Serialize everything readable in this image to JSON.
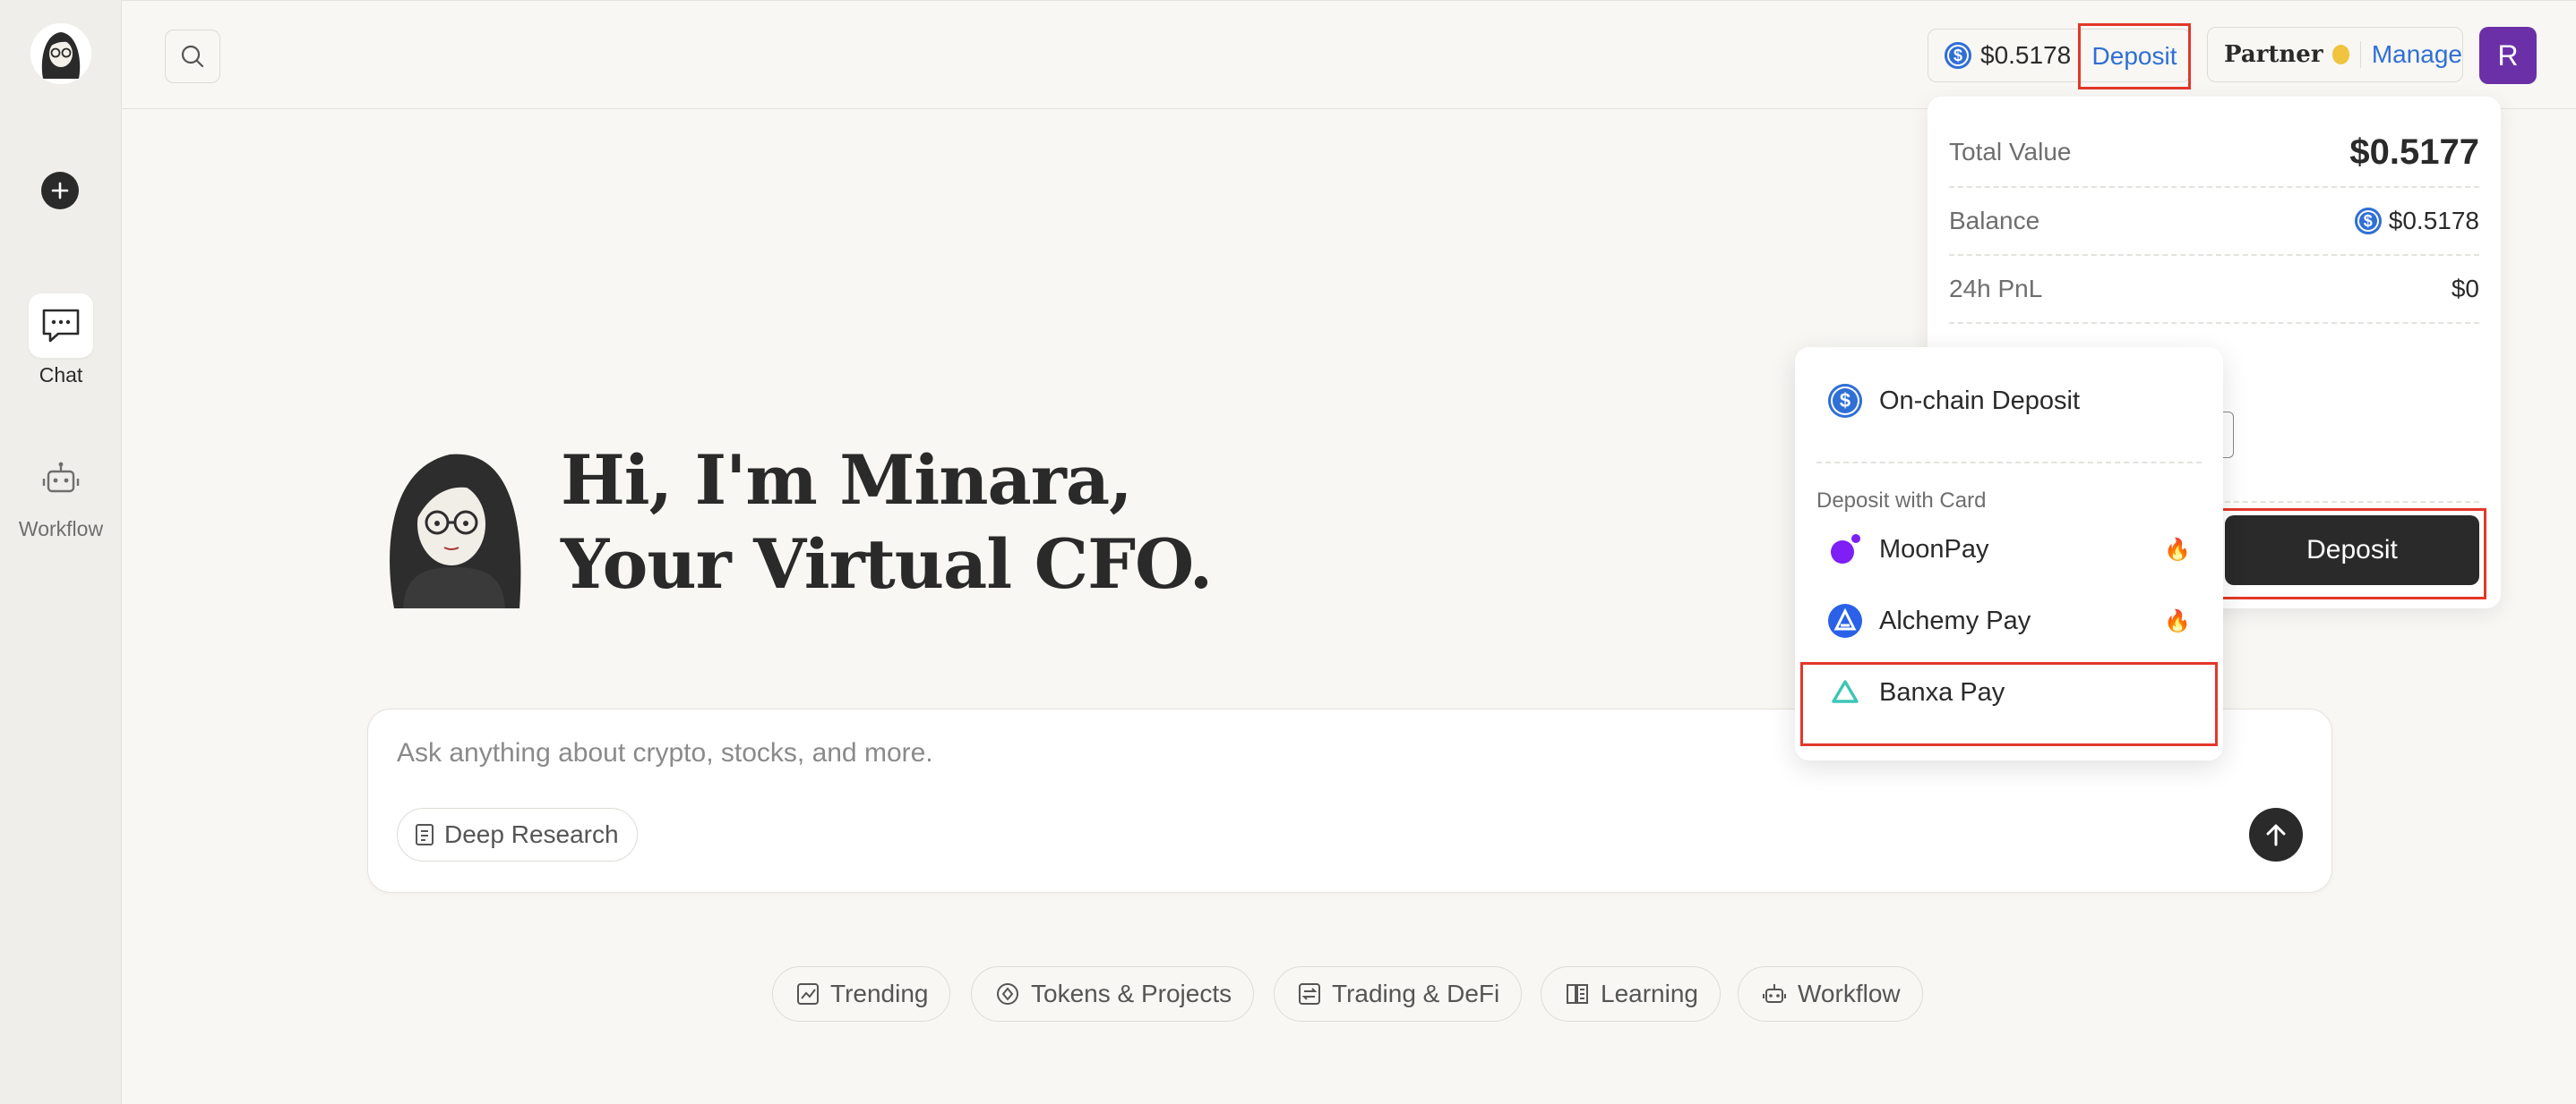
{
  "sidebar": {
    "items": [
      {
        "label": "Chat"
      },
      {
        "label": "Workflow"
      }
    ]
  },
  "header": {
    "balance": "$0.5178",
    "deposit_label": "Deposit",
    "partner_label": "Partner",
    "manage_label": "Manage",
    "user_initial": "R"
  },
  "wallet": {
    "total_value_label": "Total Value",
    "total_value": "$0.5177",
    "balance_label": "Balance",
    "balance": "$0.5178",
    "pnl_label": "24h PnL",
    "pnl": "$0",
    "deposit_button": "Deposit"
  },
  "deposit_menu": {
    "onchain": "On-chain Deposit",
    "section_title": "Deposit with Card",
    "providers": [
      {
        "label": "MoonPay",
        "hot": true
      },
      {
        "label": "Alchemy Pay",
        "hot": true
      },
      {
        "label": "Banxa Pay",
        "hot": false
      }
    ]
  },
  "hero": {
    "line1": "Hi, I'm Minara,",
    "line2": "Your Virtual CFO."
  },
  "chat": {
    "placeholder": "Ask anything about crypto, stocks, and more.",
    "deep_research": "Deep Research"
  },
  "suggestions": [
    "Trending",
    "Tokens & Projects",
    "Trading & DeFi",
    "Learning",
    "Workflow"
  ],
  "colors": {
    "accent": "#2f6fd6",
    "highlight": "#e3372a",
    "avatar": "#6b2fa8",
    "dark": "#2a2a2a"
  }
}
